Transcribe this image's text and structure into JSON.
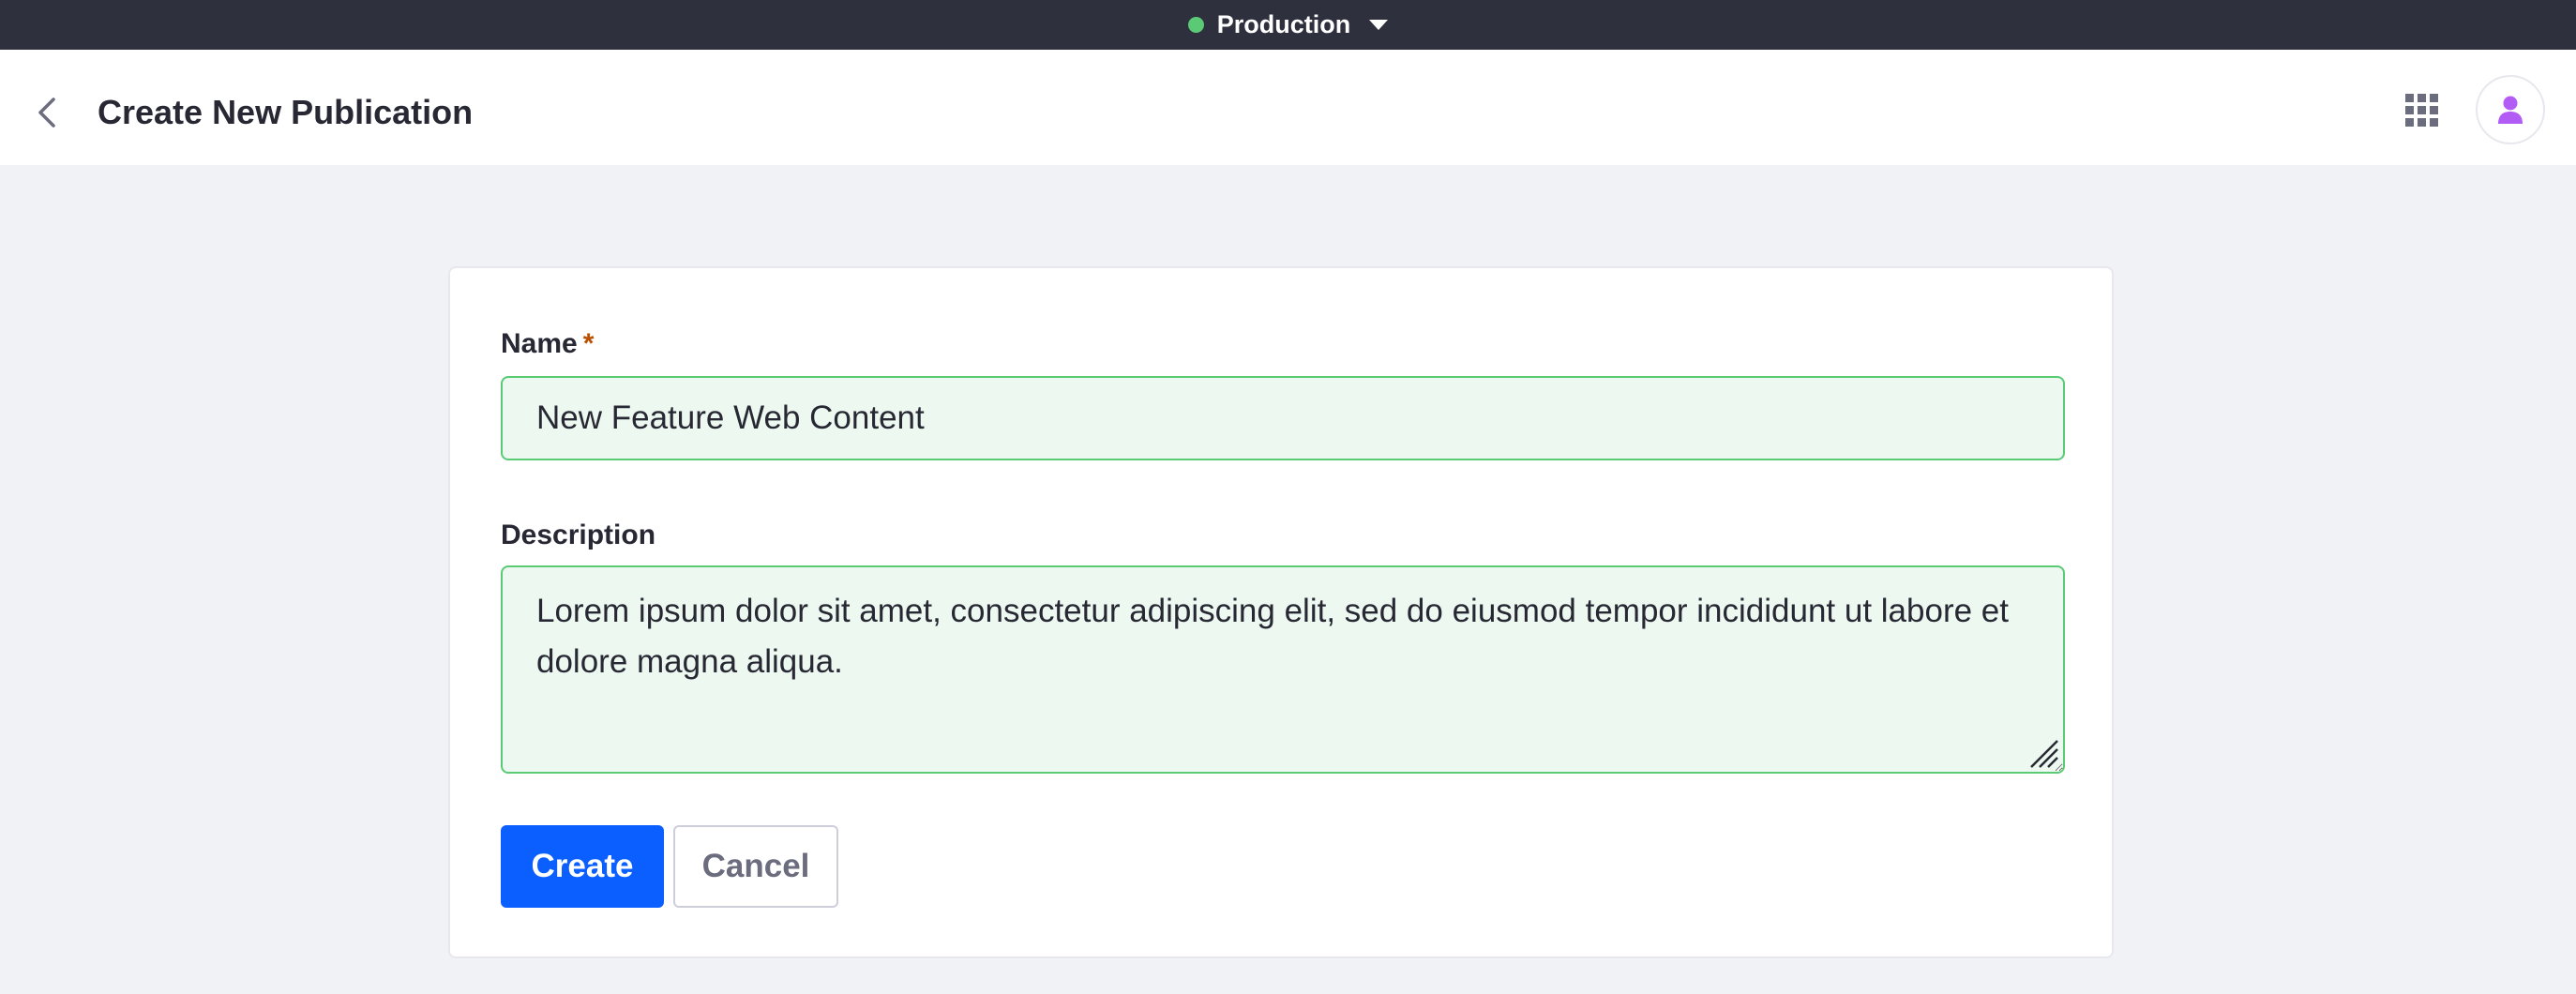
{
  "environment": {
    "label": "Production",
    "status_color": "#5aca75",
    "icon": "chevron-down-icon"
  },
  "header": {
    "title": "Create New Publication",
    "back_icon": "back-arrow-icon",
    "apps_icon": "apps-grid-icon",
    "avatar_icon": "user-icon",
    "avatar_color": "#b35cf5"
  },
  "form": {
    "name_label": "Name",
    "required_marker": "*",
    "name_value": "New Feature Web Content",
    "description_label": "Description",
    "description_value": "Lorem ipsum dolor sit amet, consectetur adipiscing elit, sed do eiusmod tempor incididunt ut labore et dolore magna aliqua."
  },
  "actions": {
    "create_label": "Create",
    "cancel_label": "Cancel"
  },
  "colors": {
    "primary": "#0b5fff",
    "success_border": "#5aca75",
    "success_bg": "#edf9f0",
    "env_bar": "#2e303e"
  }
}
